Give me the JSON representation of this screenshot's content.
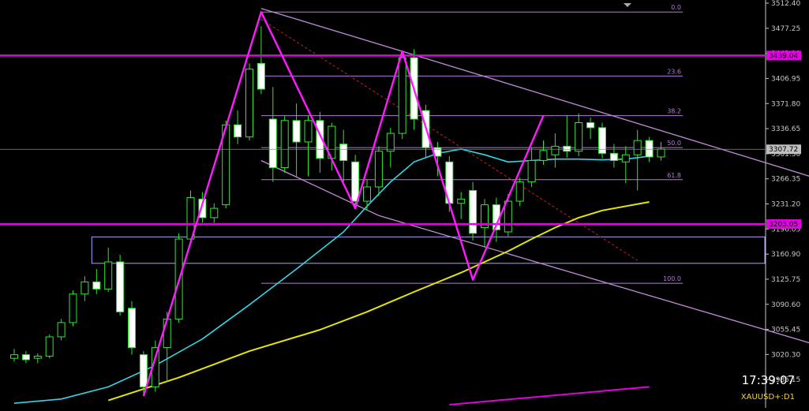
{
  "chart_data": {
    "type": "candlestick",
    "symbol": "XAUUSD+:D1",
    "clock": "17:39:07",
    "ylim": [
      2950,
      3512.4
    ],
    "price_ticks": [
      3512.4,
      3477.25,
      3442.1,
      3406.95,
      3371.8,
      3336.65,
      3301.5,
      3266.35,
      3231.2,
      3196.05,
      3160.9,
      3125.75,
      3090.6,
      3055.45,
      3020.3,
      2985.15
    ],
    "current_price": 3307.72,
    "horizontal_lines": [
      {
        "label": "3439.04",
        "value": 3439.04,
        "color": "#e600e6"
      },
      {
        "label": "3203.05",
        "value": 3203.05,
        "color": "#e600e6"
      }
    ],
    "fibonacci": {
      "high": 3500,
      "low": 3120,
      "levels": [
        {
          "label": "0.0",
          "ratio": 0
        },
        {
          "label": "23.6",
          "ratio": 0.236
        },
        {
          "label": "38.2",
          "ratio": 0.382
        },
        {
          "label": "50.0",
          "ratio": 0.5
        },
        {
          "label": "61.8",
          "ratio": 0.618
        },
        {
          "label": "100.0",
          "ratio": 1
        }
      ]
    },
    "zone": {
      "high": 3185,
      "low": 3148
    },
    "candles": [
      {
        "o": 3015,
        "h": 3028,
        "l": 3010,
        "c": 3020
      },
      {
        "o": 3020,
        "h": 3025,
        "l": 3008,
        "c": 3013
      },
      {
        "o": 3015,
        "h": 3022,
        "l": 3008,
        "c": 3018
      },
      {
        "o": 3018,
        "h": 3048,
        "l": 3015,
        "c": 3045
      },
      {
        "o": 3045,
        "h": 3070,
        "l": 3040,
        "c": 3065
      },
      {
        "o": 3065,
        "h": 3110,
        "l": 3060,
        "c": 3105
      },
      {
        "o": 3105,
        "h": 3130,
        "l": 3095,
        "c": 3122
      },
      {
        "o": 3122,
        "h": 3140,
        "l": 3105,
        "c": 3112
      },
      {
        "o": 3112,
        "h": 3170,
        "l": 3108,
        "c": 3150
      },
      {
        "o": 3150,
        "h": 3160,
        "l": 3075,
        "c": 3080
      },
      {
        "o": 3085,
        "h": 3095,
        "l": 3020,
        "c": 3030
      },
      {
        "o": 3020,
        "h": 3025,
        "l": 2962,
        "c": 2975
      },
      {
        "o": 2975,
        "h": 3040,
        "l": 2968,
        "c": 3030
      },
      {
        "o": 3030,
        "h": 3080,
        "l": 2982,
        "c": 3070
      },
      {
        "o": 3070,
        "h": 3190,
        "l": 3065,
        "c": 3182
      },
      {
        "o": 3182,
        "h": 3250,
        "l": 3178,
        "c": 3240
      },
      {
        "o": 3238,
        "h": 3248,
        "l": 3205,
        "c": 3212
      },
      {
        "o": 3212,
        "h": 3232,
        "l": 3205,
        "c": 3225
      },
      {
        "o": 3230,
        "h": 3348,
        "l": 3225,
        "c": 3342
      },
      {
        "o": 3342,
        "h": 3362,
        "l": 3315,
        "c": 3325
      },
      {
        "o": 3325,
        "h": 3428,
        "l": 3320,
        "c": 3420
      },
      {
        "o": 3428,
        "h": 3480,
        "l": 3385,
        "c": 3392
      },
      {
        "o": 3350,
        "h": 3395,
        "l": 3262,
        "c": 3282
      },
      {
        "o": 3282,
        "h": 3355,
        "l": 3275,
        "c": 3348
      },
      {
        "o": 3348,
        "h": 3372,
        "l": 3270,
        "c": 3318
      },
      {
        "o": 3318,
        "h": 3355,
        "l": 3270,
        "c": 3348
      },
      {
        "o": 3348,
        "h": 3360,
        "l": 3275,
        "c": 3295
      },
      {
        "o": 3295,
        "h": 3345,
        "l": 3278,
        "c": 3340
      },
      {
        "o": 3315,
        "h": 3335,
        "l": 3262,
        "c": 3292
      },
      {
        "o": 3290,
        "h": 3300,
        "l": 3225,
        "c": 3235
      },
      {
        "o": 3235,
        "h": 3265,
        "l": 3222,
        "c": 3255
      },
      {
        "o": 3255,
        "h": 3312,
        "l": 3242,
        "c": 3305
      },
      {
        "o": 3305,
        "h": 3338,
        "l": 3282,
        "c": 3330
      },
      {
        "o": 3330,
        "h": 3445,
        "l": 3322,
        "c": 3436
      },
      {
        "o": 3436,
        "h": 3448,
        "l": 3335,
        "c": 3350
      },
      {
        "o": 3362,
        "h": 3370,
        "l": 3295,
        "c": 3310
      },
      {
        "o": 3310,
        "h": 3318,
        "l": 3270,
        "c": 3298
      },
      {
        "o": 3290,
        "h": 3298,
        "l": 3220,
        "c": 3232
      },
      {
        "o": 3232,
        "h": 3248,
        "l": 3210,
        "c": 3238
      },
      {
        "o": 3250,
        "h": 3262,
        "l": 3180,
        "c": 3190
      },
      {
        "o": 3198,
        "h": 3238,
        "l": 3170,
        "c": 3230
      },
      {
        "o": 3230,
        "h": 3240,
        "l": 3178,
        "c": 3195
      },
      {
        "o": 3192,
        "h": 3245,
        "l": 3186,
        "c": 3235
      },
      {
        "o": 3235,
        "h": 3268,
        "l": 3228,
        "c": 3262
      },
      {
        "o": 3262,
        "h": 3310,
        "l": 3255,
        "c": 3292
      },
      {
        "o": 3292,
        "h": 3320,
        "l": 3286,
        "c": 3306
      },
      {
        "o": 3300,
        "h": 3330,
        "l": 3282,
        "c": 3312
      },
      {
        "o": 3312,
        "h": 3355,
        "l": 3296,
        "c": 3305
      },
      {
        "o": 3305,
        "h": 3358,
        "l": 3298,
        "c": 3345
      },
      {
        "o": 3345,
        "h": 3352,
        "l": 3322,
        "c": 3338
      },
      {
        "o": 3338,
        "h": 3345,
        "l": 3295,
        "c": 3302
      },
      {
        "o": 3302,
        "h": 3315,
        "l": 3282,
        "c": 3292
      },
      {
        "o": 3290,
        "h": 3312,
        "l": 3260,
        "c": 3300
      },
      {
        "o": 3300,
        "h": 3335,
        "l": 3250,
        "c": 3320
      },
      {
        "o": 3320,
        "h": 3325,
        "l": 3290,
        "c": 3297
      },
      {
        "o": 3297,
        "h": 3318,
        "l": 3292,
        "c": 3308
      }
    ],
    "ma_fast": [
      [
        0,
        2952
      ],
      [
        4,
        2958
      ],
      [
        8,
        2975
      ],
      [
        12,
        3005
      ],
      [
        16,
        3042
      ],
      [
        20,
        3090
      ],
      [
        24,
        3140
      ],
      [
        28,
        3192
      ],
      [
        30,
        3228
      ],
      [
        32,
        3262
      ],
      [
        34,
        3290
      ],
      [
        36,
        3302
      ],
      [
        38,
        3308
      ],
      [
        40,
        3300
      ],
      [
        42,
        3290
      ],
      [
        44,
        3292
      ],
      [
        46,
        3294
      ],
      [
        48,
        3294
      ],
      [
        50,
        3293
      ],
      [
        52,
        3294
      ],
      [
        54,
        3298
      ]
    ],
    "ma_slow": [
      [
        8,
        2956
      ],
      [
        14,
        2988
      ],
      [
        20,
        3025
      ],
      [
        26,
        3055
      ],
      [
        30,
        3080
      ],
      [
        34,
        3108
      ],
      [
        38,
        3135
      ],
      [
        42,
        3165
      ],
      [
        44,
        3182
      ],
      [
        46,
        3198
      ],
      [
        48,
        3212
      ],
      [
        50,
        3222
      ],
      [
        54,
        3234
      ]
    ],
    "ma_slow_tail": [
      [
        37,
        2950
      ],
      [
        54,
        2975
      ]
    ],
    "zigzag": [
      [
        11,
        2962
      ],
      [
        21,
        3500
      ],
      [
        29,
        3225
      ],
      [
        33,
        3445
      ],
      [
        39,
        3125
      ],
      [
        45,
        3355
      ]
    ],
    "channel_upper": [
      [
        21,
        3505
      ],
      [
        35,
        3435
      ],
      [
        70,
        3258
      ]
    ],
    "channel_lower": [
      [
        21,
        3292
      ],
      [
        31,
        3215
      ],
      [
        70,
        3025
      ]
    ],
    "dashed_line": [
      [
        21,
        3490
      ],
      [
        53,
        3152
      ]
    ]
  }
}
